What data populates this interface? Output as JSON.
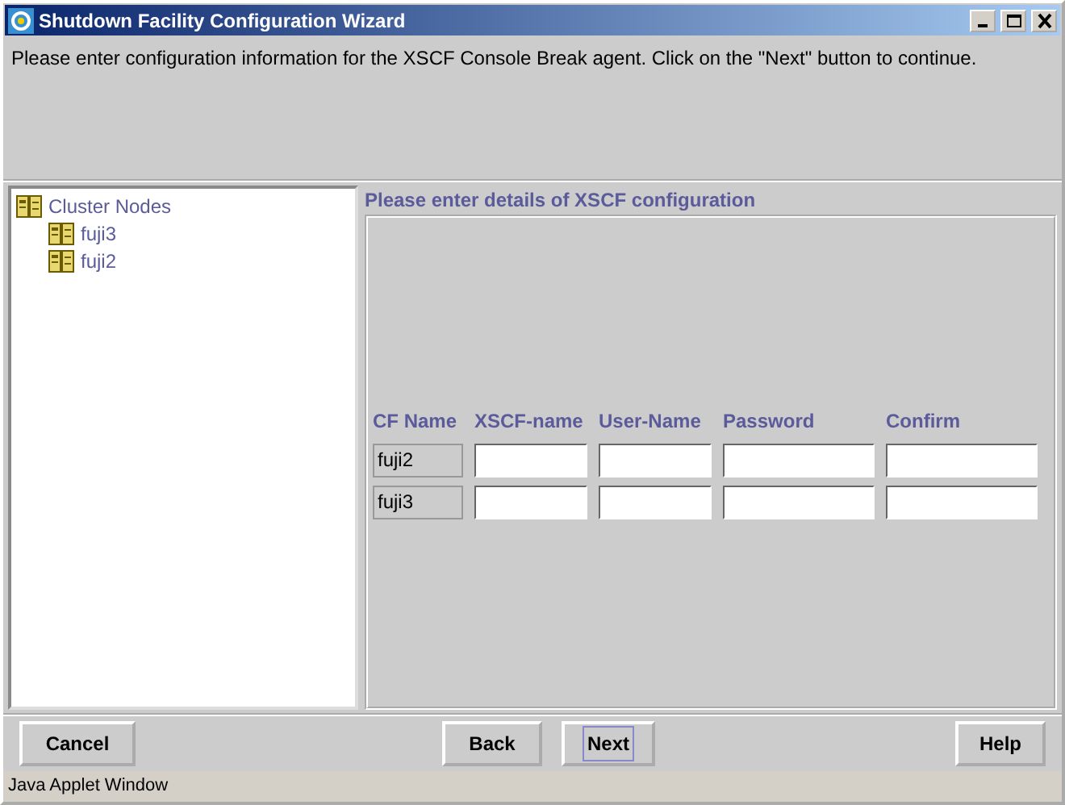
{
  "window": {
    "title": "Shutdown Facility Configuration Wizard"
  },
  "instructions": "Please enter configuration information for the XSCF Console Break agent. Click on the \"Next\" button to continue.",
  "tree": {
    "label": "Cluster Nodes",
    "children": [
      {
        "label": "fuji3"
      },
      {
        "label": "fuji2"
      }
    ]
  },
  "details": {
    "heading": "Please enter details of XSCF configuration",
    "columns": [
      "CF Name",
      "XSCF-name",
      "User-Name",
      "Password",
      "Confirm"
    ],
    "rows": [
      {
        "cf_name": "fuji2"
      },
      {
        "cf_name": "fuji3"
      }
    ]
  },
  "buttons": [
    {
      "label": "Cancel",
      "focused": false
    },
    {
      "label": "Back",
      "focused": false
    },
    {
      "label": "Next",
      "focused": true
    },
    {
      "label": "Help",
      "focused": false
    }
  ],
  "status_bar": "Java Applet Window"
}
